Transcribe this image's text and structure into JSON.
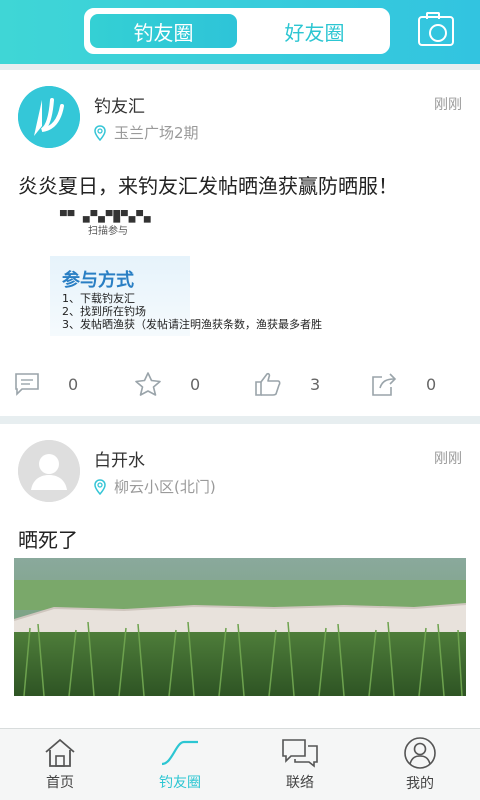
{
  "header": {
    "tabs": [
      {
        "label": "钓友圈",
        "active": true
      },
      {
        "label": "好友圈",
        "active": false
      }
    ],
    "camera_icon": "camera-icon"
  },
  "posts": [
    {
      "name": "钓友汇",
      "time": "刚刚",
      "location": "玉兰广场2期",
      "content": "炎炎夏日，来钓友汇发帖晒渔获赢防晒服！",
      "image_text": {
        "scan": "扫描参与",
        "title": "参与方式",
        "steps": [
          "1、下载钓友汇",
          "2、找到所在钓场",
          "3、发帖晒渔获（发帖请注明渔获条数，渔获最多者胜"
        ]
      },
      "counts": {
        "comments": "0",
        "favorites": "0",
        "likes": "3",
        "shares": "0"
      }
    },
    {
      "name": "白开水",
      "time": "刚刚",
      "location": "柳云小区(北门)",
      "content": "晒死了"
    }
  ],
  "tabbar": [
    {
      "label": "首页",
      "icon": "home-icon",
      "active": false
    },
    {
      "label": "钓友圈",
      "icon": "fishing-circle-icon",
      "active": true
    },
    {
      "label": "联络",
      "icon": "chat-icon",
      "active": false
    },
    {
      "label": "我的",
      "icon": "profile-icon",
      "active": false
    }
  ],
  "colors": {
    "accent": "#2cc6d2",
    "header": "#35cede"
  }
}
